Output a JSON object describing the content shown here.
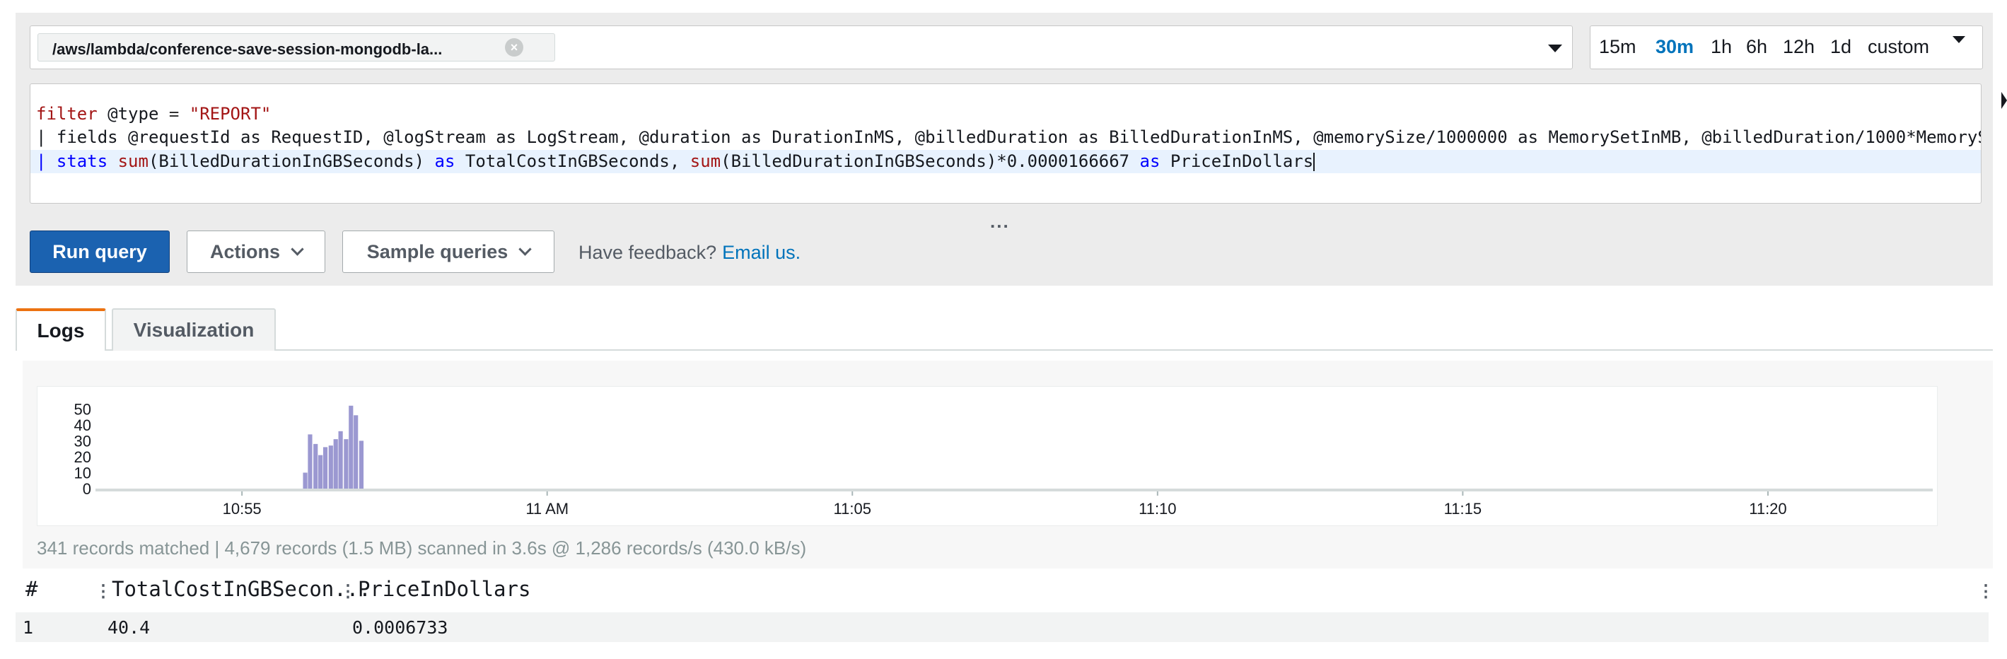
{
  "log_group": {
    "selected": "/aws/lambda/conference-save-session-mongodb-la...",
    "remove_glyph": "×",
    "dropdown_icon": "caret-down-icon"
  },
  "time_range": {
    "options": [
      "15m",
      "30m",
      "1h",
      "6h",
      "12h",
      "1d",
      "custom"
    ],
    "active": "30m",
    "dropdown_icon": "caret-down-icon"
  },
  "query": {
    "line1": {
      "k1": "filter",
      "field": " @type ",
      "op": "=",
      "str": " \"REPORT\""
    },
    "line2": "| fields @requestId as RequestID, @logStream as LogStream, @duration as DurationInMS, @billedDuration as BilledDurationInMS, @memorySize/1000000 as MemorySetInMB, @billedDuration/1000*MemoryS",
    "line3": {
      "pipe": "| ",
      "stats": "stats",
      "sum1": " sum",
      "arg1": "(BilledDurationInGBSeconds) ",
      "as1": "as",
      "alias1": " TotalCostInGBSeconds, ",
      "sum2": "sum",
      "arg2": "(BilledDurationInGBSeconds)*",
      "num": "0.0000166667",
      "as2": " as",
      "alias2": " PriceInDollars"
    },
    "resize_grip": "..."
  },
  "buttons": {
    "run": "Run query",
    "actions": "Actions",
    "samples": "Sample queries"
  },
  "feedback": {
    "text": "Have feedback?",
    "link": "Email us."
  },
  "tabs": [
    {
      "label": "Logs",
      "active": true
    },
    {
      "label": "Visualization",
      "active": false
    }
  ],
  "histogram": {
    "y_ticks": [
      "50",
      "40",
      "30",
      "20",
      "10",
      "0"
    ],
    "x_ticks": [
      "10:55",
      "11 AM",
      "11:05",
      "11:10",
      "11:15",
      "11:20"
    ],
    "bar_color": "#9b98d1",
    "ymax": 55,
    "start_minute": 52.6,
    "end_minute": 82.7,
    "bars": [
      {
        "minute": 56.0,
        "value": 10
      },
      {
        "minute": 56.08,
        "value": 34
      },
      {
        "minute": 56.17,
        "value": 28
      },
      {
        "minute": 56.25,
        "value": 21
      },
      {
        "minute": 56.33,
        "value": 26
      },
      {
        "minute": 56.42,
        "value": 27
      },
      {
        "minute": 56.5,
        "value": 31
      },
      {
        "minute": 56.58,
        "value": 36
      },
      {
        "minute": 56.67,
        "value": 31
      },
      {
        "minute": 56.75,
        "value": 52
      },
      {
        "minute": 56.83,
        "value": 46
      },
      {
        "minute": 56.92,
        "value": 30
      }
    ]
  },
  "summary": "341 records matched | 4,679 records (1.5 MB) scanned in 3.6s @ 1,286 records/s (430.0 kB/s)",
  "results": {
    "headers": [
      "#",
      "TotalCostInGBSecon...",
      "PriceInDollars"
    ],
    "rows": [
      [
        "1",
        "40.4",
        "0.0006733"
      ]
    ],
    "col_menu_icon": "column-menu-icon"
  }
}
